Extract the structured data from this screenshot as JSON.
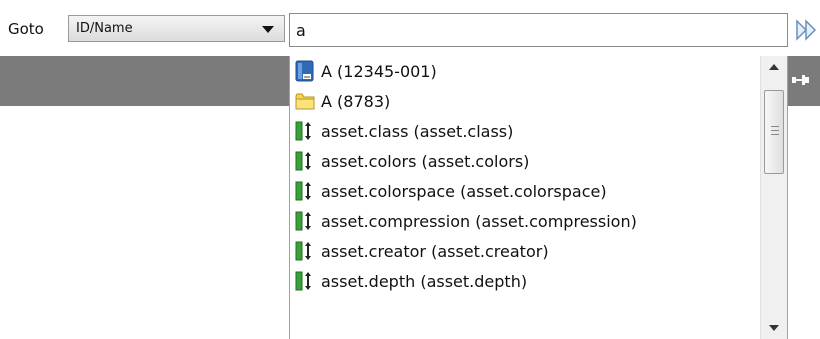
{
  "goto": {
    "label": "Goto"
  },
  "search_type": {
    "selected": "ID/Name"
  },
  "search": {
    "value": "a"
  },
  "results": [
    {
      "icon": "blue-document-icon",
      "text": "A (12345-001)"
    },
    {
      "icon": "folder-icon",
      "text": "A (8783)"
    },
    {
      "icon": "field-icon",
      "text": "asset.class (asset.class)"
    },
    {
      "icon": "field-icon",
      "text": "asset.colors (asset.colors)"
    },
    {
      "icon": "field-icon",
      "text": "asset.colorspace (asset.colorspace)"
    },
    {
      "icon": "field-icon",
      "text": "asset.compression (asset.compression)"
    },
    {
      "icon": "field-icon",
      "text": "asset.creator (asset.creator)"
    },
    {
      "icon": "field-icon",
      "text": "asset.depth (asset.depth)"
    }
  ],
  "colors": {
    "dark_bar": "#7b7b7b",
    "field_green": "#3aa13a",
    "folder_yellow": "#f7d64d"
  }
}
